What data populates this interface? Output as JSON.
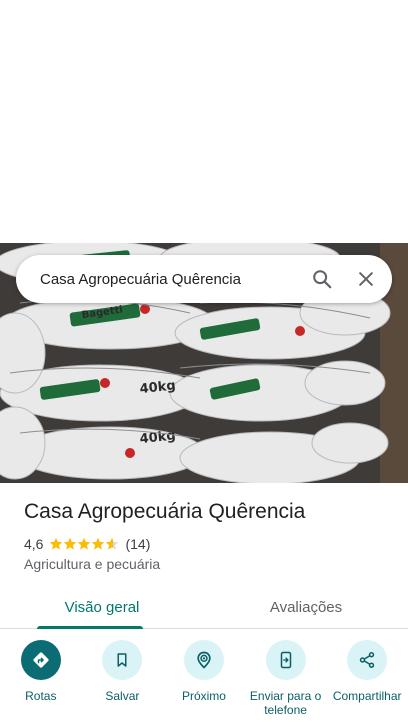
{
  "search": {
    "query": "Casa Agropecuária Quêrencia"
  },
  "photo": {
    "bag_brand": "Bagetti",
    "bag_weight": "40kg"
  },
  "place": {
    "title": "Casa Agropecuária Quêrencia",
    "rating": "4,6",
    "rating_value": 4.6,
    "reviews": "(14)",
    "category": "Agricultura e pecuária"
  },
  "tabs": [
    {
      "label": "Visão geral",
      "active": true
    },
    {
      "label": "Avaliações",
      "active": false
    }
  ],
  "actions": [
    {
      "label": "Rotas",
      "icon": "directions-icon"
    },
    {
      "label": "Salvar",
      "icon": "bookmark-icon"
    },
    {
      "label": "Próximo",
      "icon": "nearby-icon"
    },
    {
      "label": "Enviar para o telefone",
      "icon": "send-to-phone-icon"
    },
    {
      "label": "Compartilhar",
      "icon": "share-icon"
    }
  ],
  "colors": {
    "accent": "#00796b",
    "action_bg": "#d9f3f6",
    "primary_action": "#0b6d73",
    "star": "#fbbc04"
  }
}
